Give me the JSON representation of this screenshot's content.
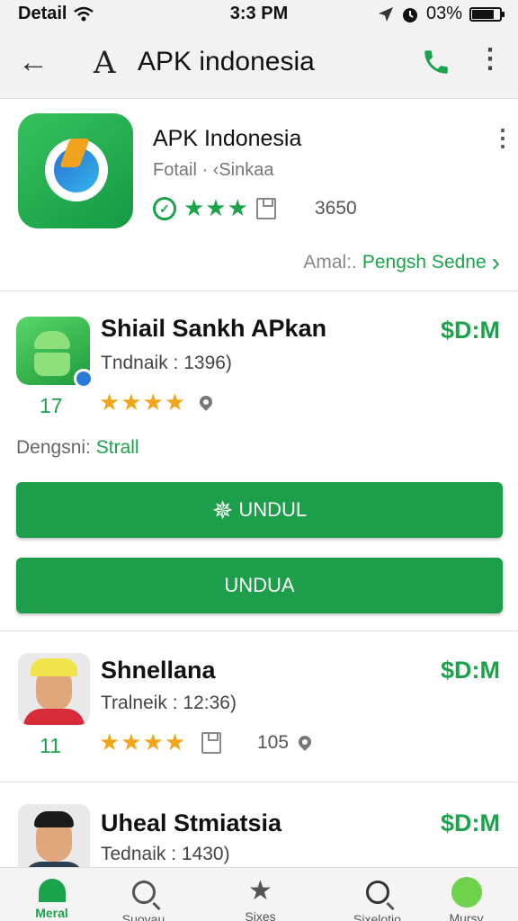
{
  "status_bar": {
    "carrier": "Detail",
    "time": "3:3 PM",
    "battery": "03%",
    "battery_level": 0.8
  },
  "app_bar": {
    "back_icon": "arrow-left-icon",
    "logo_glyph": "A",
    "title": "APK indonesia",
    "phone_icon": "phone-icon",
    "more_icon": "more-vert-icon",
    "accent": "#1aa34a"
  },
  "featured": {
    "title": "APK Indonesia",
    "subtitle": "Fotail · ‹Sinkaa",
    "stars": "★★★",
    "count": "3650",
    "footer_muted": "Amal:.",
    "footer_link": "Pengsh Sedne",
    "chevron": "›"
  },
  "apps": [
    {
      "title": "Shiail Sankh APkan",
      "sub": "Tndnaik : 1396)",
      "price": "$D:M",
      "num": "17",
      "stars": "★★★★",
      "rating": 3.5,
      "developer_label": "Dengsni:",
      "developer_value": "Strall",
      "button_primary": "UNDUL",
      "button_secondary": "UNDUA"
    },
    {
      "title": "Shnellana",
      "sub": "Tralneik : 12:36)",
      "price": "$D:M",
      "num": "11",
      "stars": "★★★★",
      "rating": 3.5,
      "count": "105"
    },
    {
      "title": "Uheal Stmiatsia",
      "sub": "Tednaik : 1430)",
      "price": "$D:M"
    }
  ],
  "bottom_nav": [
    {
      "label": "Meral",
      "icon": "home-icon",
      "active": true
    },
    {
      "label": "Suoyau",
      "icon": "search-icon",
      "active": false
    },
    {
      "label": "Sixes",
      "icon": "star-icon",
      "active": false
    },
    {
      "label": "Sixelotio",
      "icon": "explore-icon",
      "active": false
    },
    {
      "label": "Mursy",
      "icon": "avatar-icon",
      "active": false
    }
  ]
}
